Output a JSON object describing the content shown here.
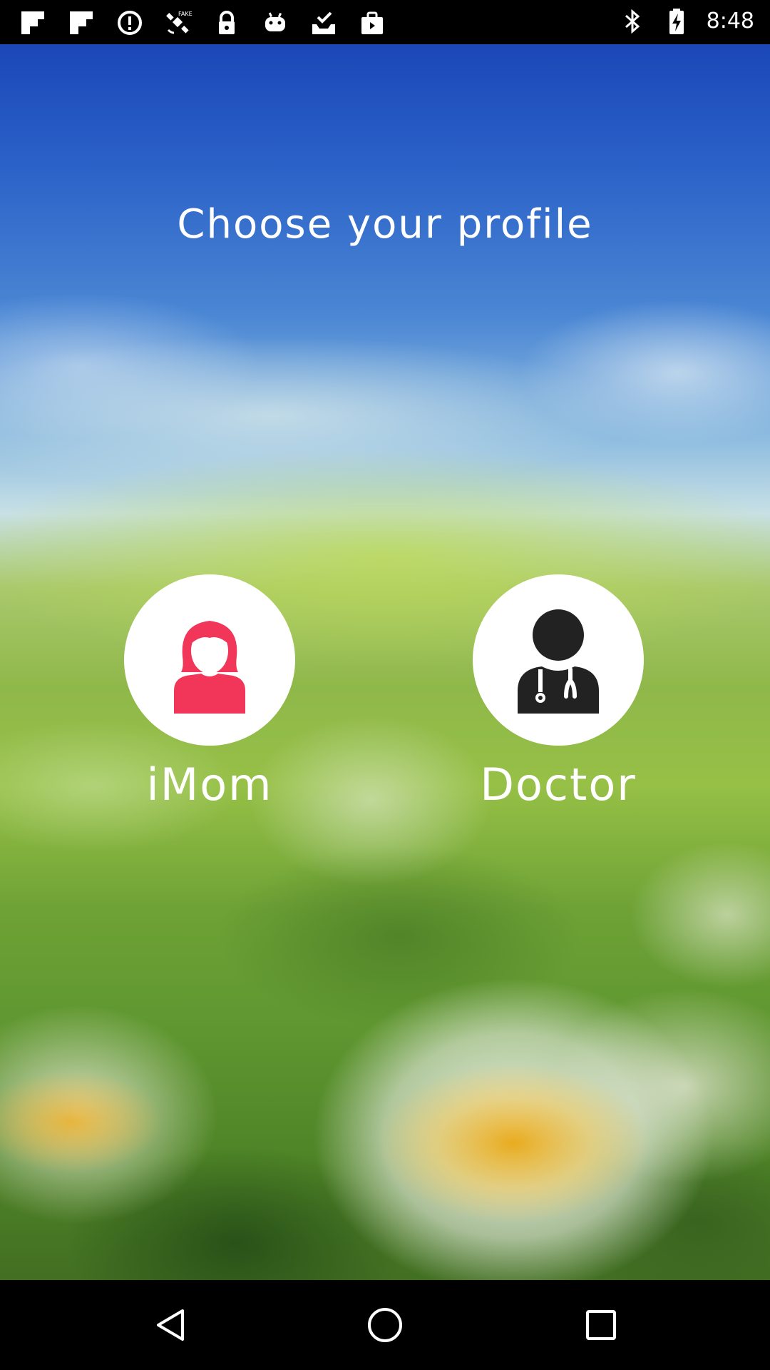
{
  "status_bar": {
    "time": "8:48",
    "left_icons": [
      "flipboard-icon",
      "flipboard-icon",
      "alert-icon",
      "fake-gps-icon",
      "lock-icon",
      "android-icon",
      "download-done-icon",
      "bag-icon"
    ],
    "right_icons": [
      "bluetooth-icon",
      "battery-charging-icon"
    ]
  },
  "main": {
    "title": "Choose your profile",
    "profiles": [
      {
        "label": "iMom",
        "icon": "woman-icon",
        "icon_color": "#f2365a"
      },
      {
        "label": "Doctor",
        "icon": "doctor-icon",
        "icon_color": "#222222"
      }
    ]
  },
  "nav_bar": {
    "buttons": [
      "back-icon",
      "home-icon",
      "recent-apps-icon"
    ]
  }
}
